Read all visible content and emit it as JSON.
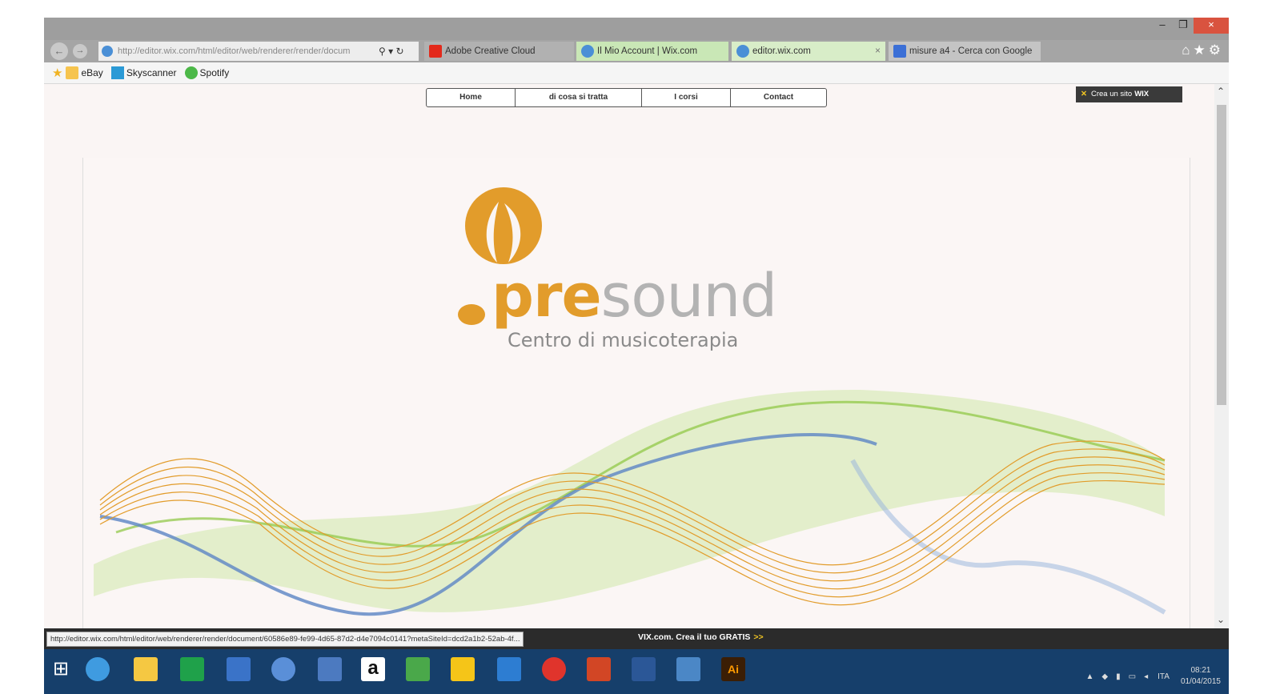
{
  "browser": {
    "address_url": "http://editor.wix.com/html/editor/web/renderer/render/docum",
    "tabs": [
      {
        "label": "Adobe Creative Cloud",
        "color": "#e3291b"
      },
      {
        "label": "Il Mio Account | Wix.com",
        "color": "#4a8fd6"
      },
      {
        "label": "editor.wix.com",
        "color": "#4a8fd6",
        "active": true
      },
      {
        "label": "misure a4 - Cerca con Google",
        "color": "#3b6fd6"
      }
    ],
    "favorites": [
      {
        "label": "eBay"
      },
      {
        "label": "Skyscanner"
      },
      {
        "label": "Spotify"
      }
    ],
    "tools_icons": [
      "home-icon",
      "star-icon",
      "gear-icon"
    ]
  },
  "site": {
    "menu": [
      "Home",
      "di cosa si tratta",
      "I corsi",
      "Contact"
    ],
    "wix_badge": {
      "text": "Crea un sito",
      "brand": "WIX"
    },
    "logo": {
      "bold": "pre",
      "light": "sound",
      "subtitle": "Centro di musicoterapia"
    },
    "colors": {
      "orange": "#e29c2b",
      "green": "#8cc63f",
      "blue": "#5b84c4",
      "grey": "#b3b3b3"
    }
  },
  "statusbar": {
    "url": "http://editor.wix.com/html/editor/web/renderer/render/document/60586e89-fe99-4d65-87d2-d4e7094c0141?metaSiteId=dcd2a1b2-52ab-4f...",
    "promo": "VIX.com. Crea il tuo GRATIS",
    "promo_arrow": ">>"
  },
  "taskbar": {
    "apps": [
      "start",
      "internet-explorer",
      "file-explorer",
      "store",
      "remote-desktop",
      "app",
      "app",
      "amazon",
      "evernote",
      "google-drive",
      "outlook",
      "creative-cloud",
      "powerpoint",
      "word",
      "photos",
      "illustrator"
    ],
    "tray": {
      "lang": "ITA",
      "time": "08:21",
      "date": "01/04/2015"
    }
  }
}
